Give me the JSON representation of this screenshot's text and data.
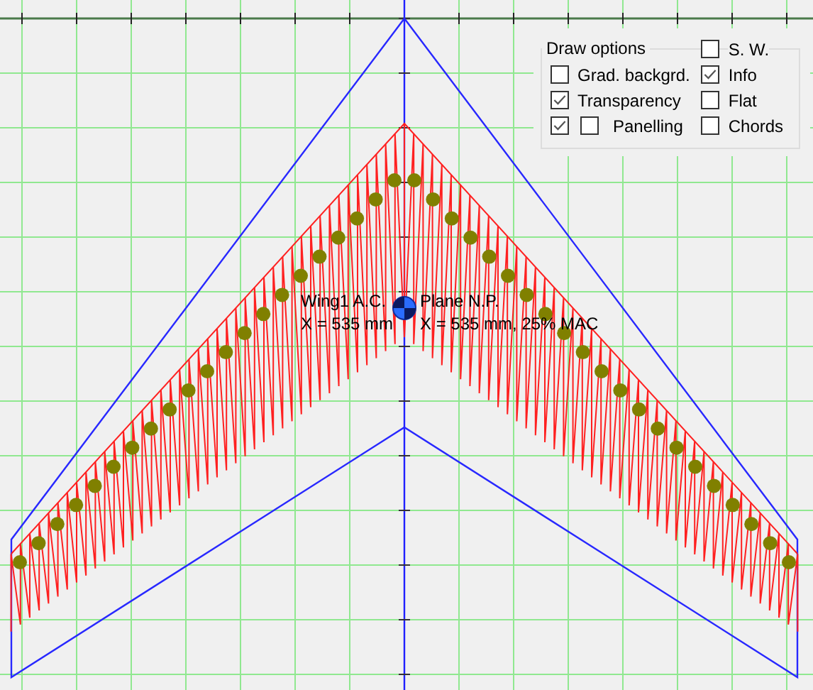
{
  "draw_options": {
    "title": "Draw options",
    "left": [
      {
        "label": "Grad. backgrd.",
        "kind": "single",
        "checked": false
      },
      {
        "label": "Transparency",
        "kind": "single",
        "checked": true
      },
      {
        "label": "Panelling",
        "kind": "pair",
        "lead_checked": true,
        "checked": false
      }
    ],
    "right": [
      {
        "label": "S. W.",
        "checked": false
      },
      {
        "label": "Info",
        "checked": true
      },
      {
        "label": "Flat",
        "checked": false
      },
      {
        "label": "Chords",
        "checked": false
      }
    ]
  },
  "info": [
    {
      "lines": [
        "Wing1 A.C.",
        "X = 535 mm"
      ]
    },
    {
      "lines": [
        "Plane N.P.",
        "X = 535 mm, 25% MAC"
      ]
    }
  ]
}
